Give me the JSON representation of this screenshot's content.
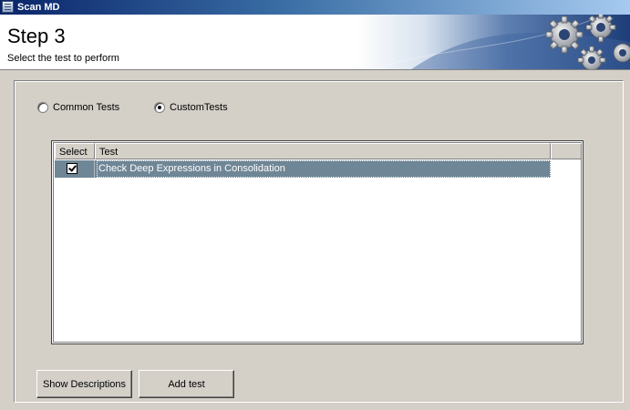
{
  "window": {
    "title": "Scan MD",
    "icon": "document-icon"
  },
  "header": {
    "title": "Step 3",
    "subtitle": "Select the test to perform",
    "banner_icon": "gears-icon"
  },
  "test_type": {
    "options": [
      {
        "label": "Common Tests",
        "checked": false
      },
      {
        "label": "CustomTests",
        "checked": true
      }
    ]
  },
  "grid": {
    "columns": [
      "Select",
      "Test"
    ],
    "rows": [
      {
        "selected": true,
        "test": "Check Deep Expressions in Consolidation"
      }
    ]
  },
  "buttons": {
    "show_descriptions": "Show Descriptions",
    "add_test": "Add test"
  },
  "colors": {
    "titlebar_start": "#0a246a",
    "titlebar_end": "#a6caf0",
    "selected_row": "#6f8696",
    "window_bg": "#d4d0c8"
  }
}
